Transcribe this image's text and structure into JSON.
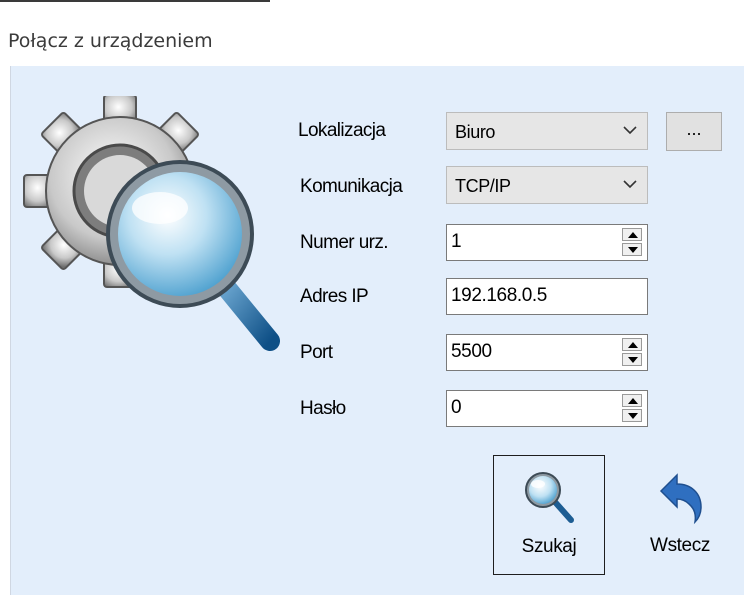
{
  "window": {
    "title": "Połącz z urządzeniem"
  },
  "form": {
    "location": {
      "label": "Lokalizacja",
      "value": "Biuro",
      "browse_label": "..."
    },
    "communication": {
      "label": "Komunikacja",
      "value": "TCP/IP"
    },
    "device_number": {
      "label": "Numer urz.",
      "value": "1"
    },
    "ip_address": {
      "label": "Adres IP",
      "value": "192.168.0.5"
    },
    "port": {
      "label": "Port",
      "value": "5500"
    },
    "password": {
      "label": "Hasło",
      "value": "0"
    }
  },
  "buttons": {
    "search": {
      "label": "Szukaj",
      "icon": "magnifier-icon"
    },
    "back": {
      "label": "Wstecz",
      "icon": "undo-arrow-icon"
    }
  },
  "logo": {
    "icon": "gear-magnifier-icon"
  },
  "colors": {
    "client_background": "#e3eefb",
    "back_arrow": "#2f6fc0"
  }
}
